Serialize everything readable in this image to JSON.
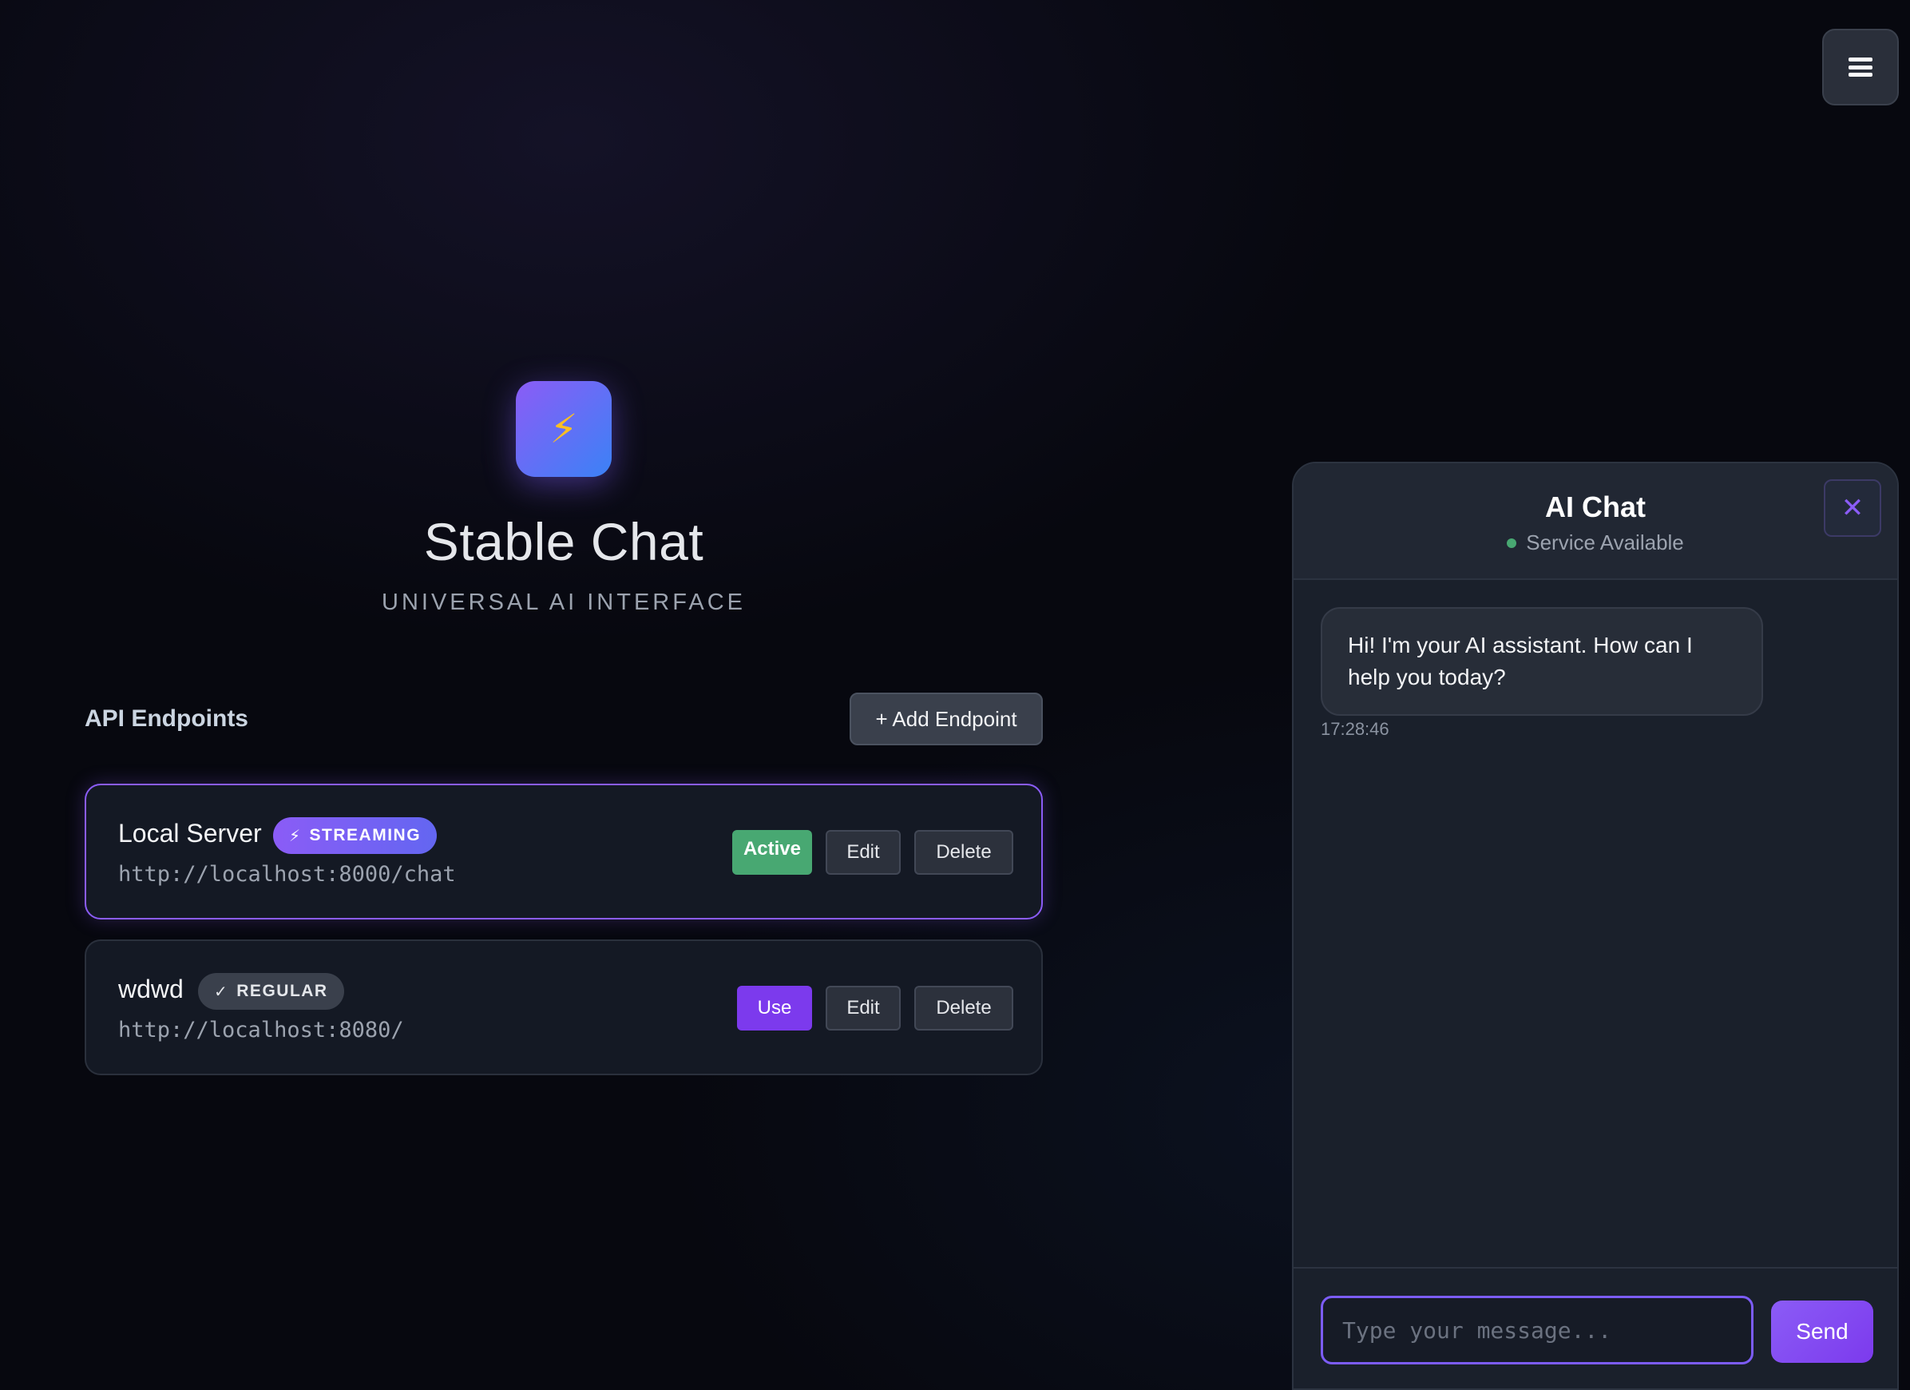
{
  "menu": {
    "icon": "hamburger-icon"
  },
  "hero": {
    "logo_icon": "lightning-icon",
    "logo_glyph": "⚡",
    "title": "Stable Chat",
    "subtitle": "UNIVERSAL AI INTERFACE"
  },
  "endpoints": {
    "heading": "API Endpoints",
    "add_label": "+ Add Endpoint",
    "items": [
      {
        "name": "Local Server",
        "badge_icon": "⚡",
        "badge": "STREAMING",
        "url": "http://localhost:8000/chat",
        "status": "Active",
        "edit": "Edit",
        "delete": "Delete"
      },
      {
        "name": "wdwd",
        "badge_icon": "✓",
        "badge": "REGULAR",
        "url": "http://localhost:8080/",
        "use": "Use",
        "edit": "Edit",
        "delete": "Delete"
      }
    ]
  },
  "chat": {
    "title": "AI Chat",
    "status": "Service Available",
    "close_glyph": "✕",
    "messages": [
      {
        "text": "Hi! I'm your AI assistant. How can I help you today?",
        "time": "17:28:46"
      }
    ],
    "input_placeholder": "Type your message...",
    "send_label": "Send"
  },
  "colors": {
    "accent": "#8b5cf6",
    "active_green": "#48a872",
    "background": "#07080f"
  }
}
